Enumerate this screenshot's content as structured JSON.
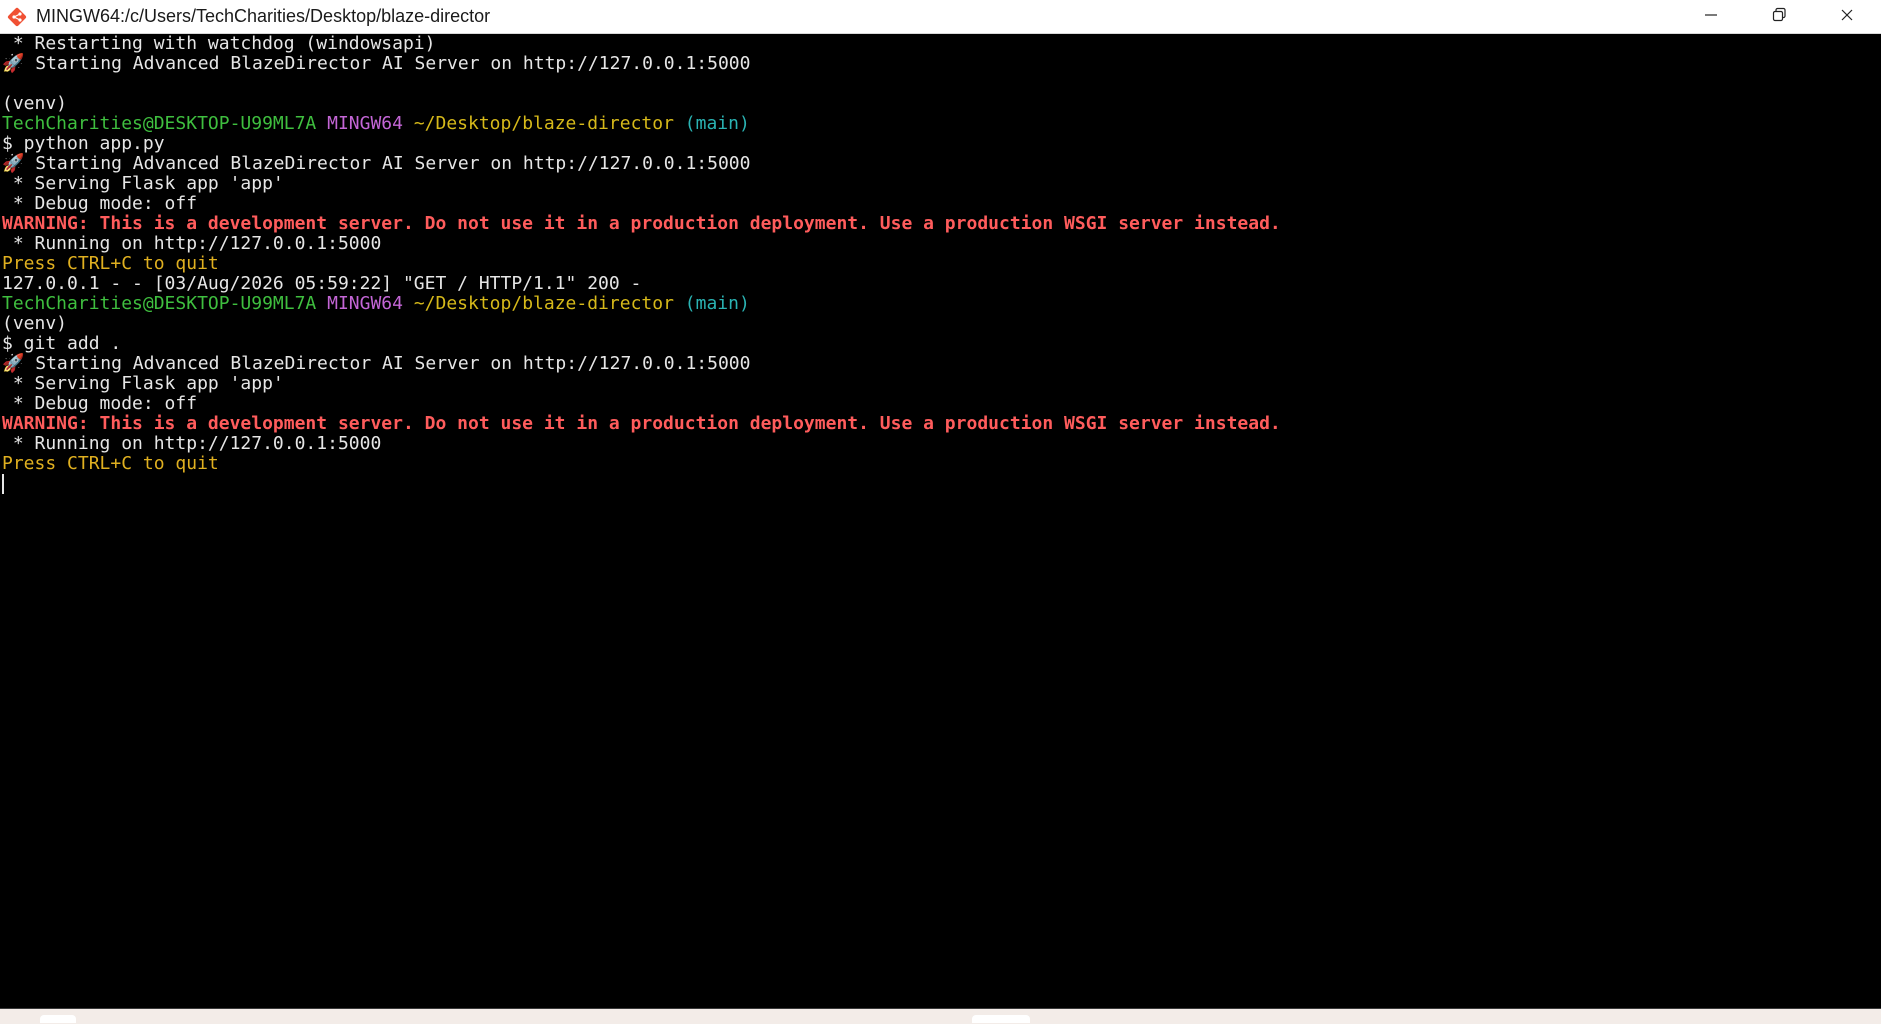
{
  "window": {
    "title": "MINGW64:/c/Users/TechCharities/Desktop/blaze-director",
    "icon": "git-bash-icon",
    "controls": [
      "minimize-icon",
      "restore-icon",
      "close-icon"
    ]
  },
  "colors": {
    "user_host": "#3fbf3f",
    "mingw": "#c466d6",
    "path": "#d6b91a",
    "branch": "#2ab3b3",
    "warning": "#ff5c5c",
    "quit_hint": "#e0b020"
  },
  "terminal": {
    "lines": [
      [
        {
          "t": " * Restarting with watchdog (windowsapi)",
          "c": "default"
        }
      ],
      [
        {
          "t": "🚀 Starting Advanced BlazeDirector AI Server on http://127.0.0.1:5000",
          "c": "default"
        }
      ],
      [
        {
          "t": "",
          "c": "default"
        }
      ],
      [
        {
          "t": "(venv)",
          "c": "default"
        }
      ],
      [
        {
          "t": "TechCharities@DESKTOP-U99ML7A",
          "c": "green"
        },
        {
          "t": " ",
          "c": "default"
        },
        {
          "t": "MINGW64",
          "c": "magenta"
        },
        {
          "t": " ",
          "c": "default"
        },
        {
          "t": "~/Desktop/blaze-director",
          "c": "yellow"
        },
        {
          "t": " ",
          "c": "default"
        },
        {
          "t": "(main)",
          "c": "cyan"
        }
      ],
      [
        {
          "t": "$ python app.py",
          "c": "default"
        }
      ],
      [
        {
          "t": "🚀 Starting Advanced BlazeDirector AI Server on http://127.0.0.1:5000",
          "c": "default"
        }
      ],
      [
        {
          "t": " * Serving Flask app 'app'",
          "c": "default"
        }
      ],
      [
        {
          "t": " * Debug mode: off",
          "c": "default"
        }
      ],
      [
        {
          "t": "WARNING: This is a development server. Do not use it in a production deployment. Use a production WSGI server instead.",
          "c": "red"
        }
      ],
      [
        {
          "t": " * Running on http://127.0.0.1:5000",
          "c": "default"
        }
      ],
      [
        {
          "t": "Press CTRL+C to quit",
          "c": "amber"
        }
      ],
      [
        {
          "t": "127.0.0.1 - - [03/Aug/2026 05:59:22] \"GET / HTTP/1.1\" 200 -",
          "c": "default"
        }
      ],
      [
        {
          "t": "TechCharities@DESKTOP-U99ML7A",
          "c": "green"
        },
        {
          "t": " ",
          "c": "default"
        },
        {
          "t": "MINGW64",
          "c": "magenta"
        },
        {
          "t": " ",
          "c": "default"
        },
        {
          "t": "~/Desktop/blaze-director",
          "c": "yellow"
        },
        {
          "t": " ",
          "c": "default"
        },
        {
          "t": "(main)",
          "c": "cyan"
        }
      ],
      [
        {
          "t": "(venv)",
          "c": "default"
        }
      ],
      [
        {
          "t": "$ git add .",
          "c": "default"
        }
      ],
      [
        {
          "t": "🚀 Starting Advanced BlazeDirector AI Server on http://127.0.0.1:5000",
          "c": "default"
        }
      ],
      [
        {
          "t": " * Serving Flask app 'app'",
          "c": "default"
        }
      ],
      [
        {
          "t": " * Debug mode: off",
          "c": "default"
        }
      ],
      [
        {
          "t": "WARNING: This is a development server. Do not use it in a production deployment. Use a production WSGI server instead.",
          "c": "red"
        }
      ],
      [
        {
          "t": " * Running on http://127.0.0.1:5000",
          "c": "default"
        }
      ],
      [
        {
          "t": "Press CTRL+C to quit",
          "c": "amber"
        }
      ]
    ]
  }
}
